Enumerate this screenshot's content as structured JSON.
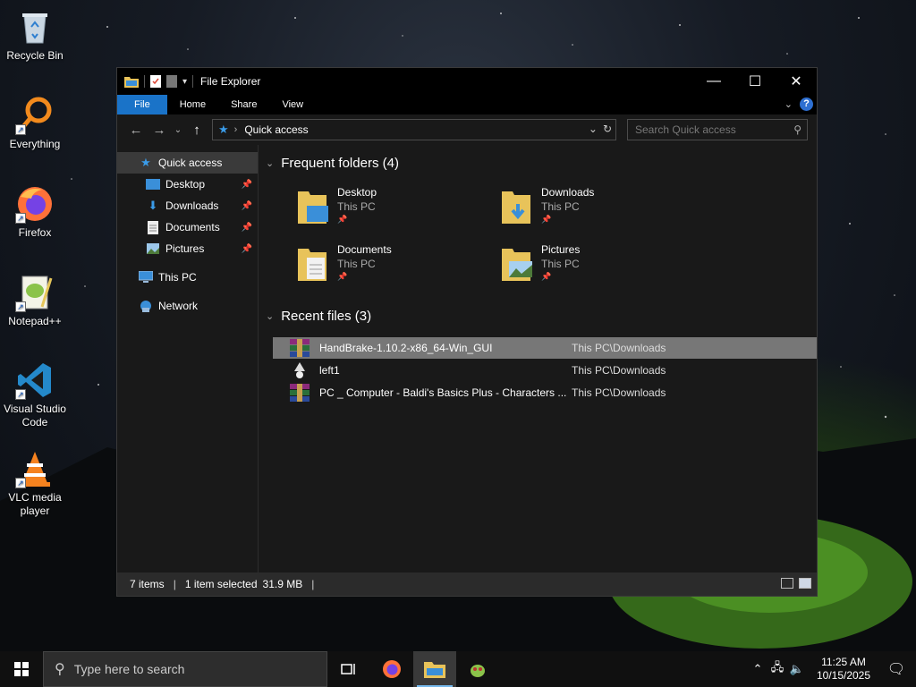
{
  "desktop": {
    "icons": [
      {
        "label": "Recycle Bin",
        "icon": "recycle-bin-icon"
      },
      {
        "label": "Everything",
        "icon": "everything-search-icon"
      },
      {
        "label": "Firefox",
        "icon": "firefox-icon"
      },
      {
        "label": "Notepad++",
        "icon": "notepad-plus-plus-icon"
      },
      {
        "label": "Visual Studio Code",
        "icon": "vscode-icon"
      },
      {
        "label": "VLC media player",
        "icon": "vlc-icon"
      }
    ]
  },
  "window": {
    "title": "File Explorer",
    "controls": {
      "minimize": "—",
      "maximize": "☐",
      "close": "✕"
    },
    "ribbon_tabs": [
      "File",
      "Home",
      "Share",
      "View"
    ],
    "address": {
      "crumb": "Quick access",
      "search_placeholder": "Search Quick access"
    },
    "nav": {
      "quick_access": "Quick access",
      "pinned": [
        "Desktop",
        "Downloads",
        "Documents",
        "Pictures"
      ],
      "this_pc": "This PC",
      "network": "Network"
    },
    "frequent": {
      "header": "Frequent folders (4)",
      "folders": [
        {
          "name": "Desktop",
          "location": "This PC"
        },
        {
          "name": "Downloads",
          "location": "This PC"
        },
        {
          "name": "Documents",
          "location": "This PC"
        },
        {
          "name": "Pictures",
          "location": "This PC"
        }
      ]
    },
    "recent": {
      "header": "Recent files (3)",
      "files": [
        {
          "name": "HandBrake-1.10.2-x86_64-Win_GUI",
          "path": "This PC\\Downloads",
          "selected": true
        },
        {
          "name": "left1",
          "path": "This PC\\Downloads",
          "selected": false
        },
        {
          "name": "PC _ Computer - Baldi's Basics Plus - Characters ...",
          "path": "This PC\\Downloads",
          "selected": false
        }
      ]
    },
    "status": {
      "items": "7 items",
      "selection": "1 item selected",
      "size": "31.9 MB"
    }
  },
  "taskbar": {
    "search_placeholder": "Type here to search",
    "time": "11:25 AM",
    "date": "10/15/2025"
  },
  "colors": {
    "accent": "#1a73c8",
    "selection": "#777777",
    "window_bg": "#191919"
  }
}
